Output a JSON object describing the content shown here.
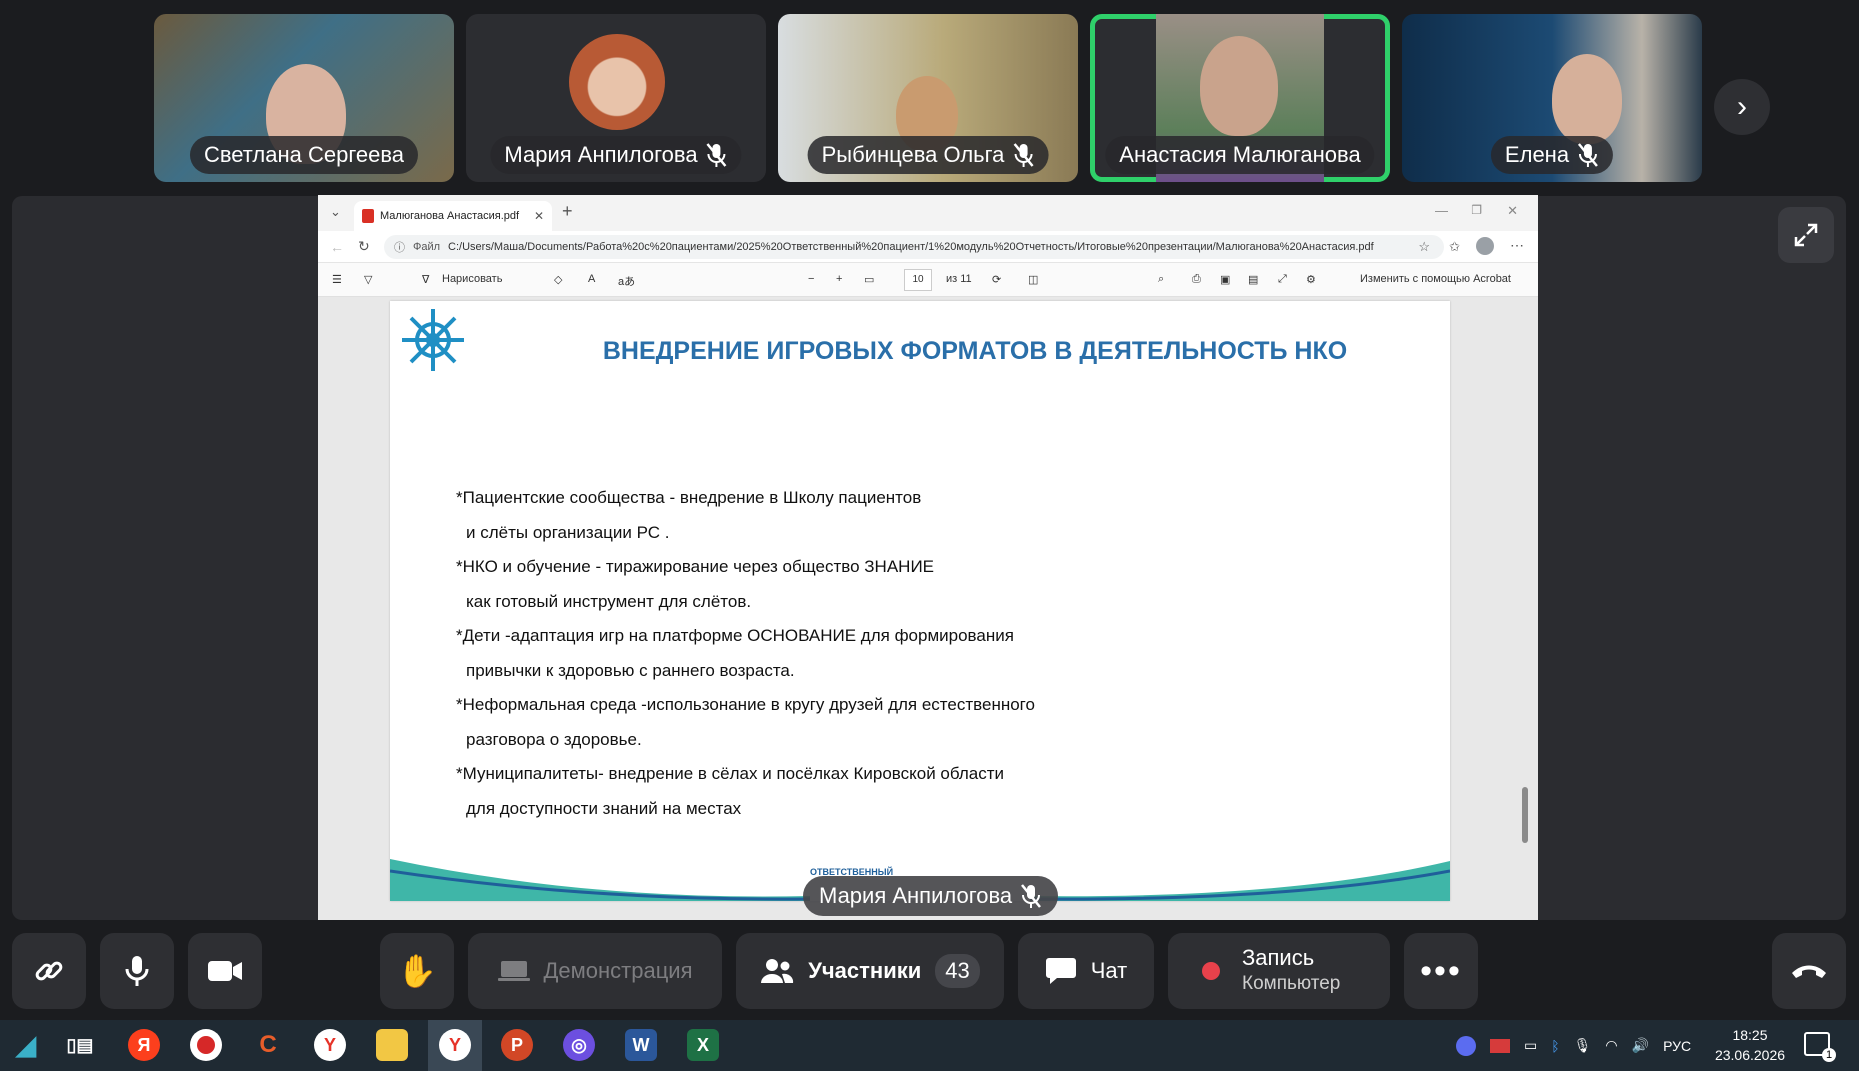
{
  "participants": [
    {
      "name": "Светлана Сергеева",
      "muted": false,
      "active": false
    },
    {
      "name": "Мария Анпилогова",
      "muted": true,
      "active": false
    },
    {
      "name": "Рыбинцева Ольга",
      "muted": true,
      "active": false
    },
    {
      "name": "Анастасия Малюганова",
      "muted": false,
      "active": true
    },
    {
      "name": "Елена",
      "muted": true,
      "active": false
    }
  ],
  "browser": {
    "tab_title": "Малюганова Анастасия.pdf",
    "url_prefix": "Файл",
    "url": "C:/Users/Маша/Documents/Работа%20с%20пациентами/2025%20Ответственный%20пациент/1%20модуль%20Отчетность/Итоговые%20презентации/Малюганова%20Анастасия.pdf",
    "draw_label": "Нарисовать",
    "page_current": "10",
    "page_total": "из 11",
    "acrobat_label": "Изменить с помощью Acrobat"
  },
  "slide": {
    "title": "ВНЕДРЕНИЕ ИГРОВЫХ ФОРМАТОВ В ДЕЯТЕЛЬНОСТЬ НКО",
    "lines": [
      "*Пациентские сообщества - внедрение в Школу пациентов",
      "   и слёты организации РС .",
      "*НКО и обучение - тиражирование через общество ЗНАНИЕ",
      "  как готовый инструмент для слётов.",
      "*Дети -адаптация игр на платформе ОСНОВАНИЕ для формирования",
      "  привычки к здоровью с раннего возраста.",
      "*Неформальная среда -использонание в кругу друзей для естественного",
      "  разговора о здоровье.",
      "*Муниципалитеты- внедрение в сёлах и посёлках Кировской области",
      "   для доступности знаний на местах"
    ],
    "footer_logo_text": "ОТВЕТСТВЕННЫЙ"
  },
  "speaker": {
    "name": "Мария Анпилогова"
  },
  "controls": {
    "screen_share": "Демонстрация",
    "participants_label": "Участники",
    "participants_count": "43",
    "chat": "Чат",
    "record_title": "Запись",
    "record_sub": "Компьютер"
  },
  "taskbar": {
    "lang": "РУС",
    "time": "18:25",
    "date": "23.06.2026",
    "notif_count": "1"
  },
  "colors": {
    "active_border": "#2fd06a",
    "title_blue": "#2a6fa9",
    "record_dot": "#e8414b"
  }
}
